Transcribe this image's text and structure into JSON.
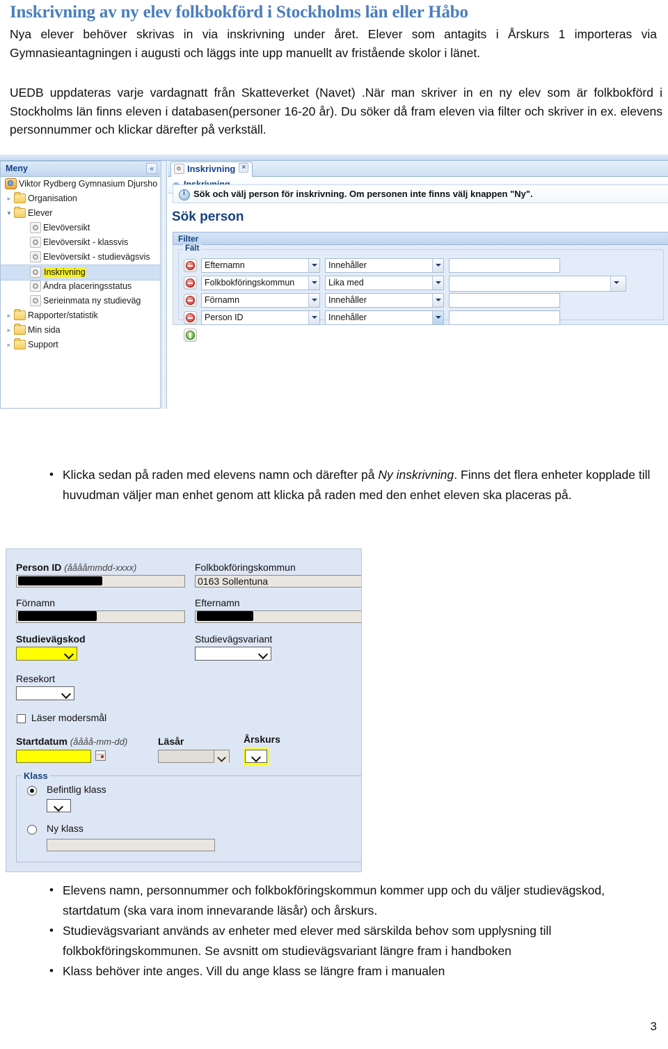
{
  "document": {
    "title": "Inskrivning av ny elev folkbokförd i Stockholms län eller Håbo",
    "paragraph1": "Nya elever behöver skrivas in via inskrivning under året. Elever som antagits i Årskurs 1 importeras via Gymnasieantagningen i augusti och läggs inte upp manuellt av fristående skolor i länet.",
    "paragraph2": "UEDB uppdateras varje vardagnatt från Skatteverket (Navet) .När man skriver in en ny elev som är folkbokförd i Stockholms län finns eleven i databasen(personer 16-20 år). Du söker då fram eleven via filter och skriver in ex. elevens personnummer och klickar därefter på verkställ.",
    "page_number": "3",
    "title_color": "#4A7EBB"
  },
  "bullets_middle": [
    {
      "pre": "Klicka sedan på raden med elevens namn och därefter på ",
      "italic": "Ny inskrivning",
      "post": ". Finns det flera enheter kopplade till huvudman väljer man enhet genom att klicka på raden med den enhet eleven ska placeras på."
    }
  ],
  "bullets_bottom": [
    "Elevens namn, personnummer och folkbokföringskommun kommer upp och du väljer studievägskod, startdatum (ska vara inom innevarande läsår) och årskurs.",
    "Studievägsvariant används av enheter med elever med särskilda behov som upplysning till folkbokföringskommunen. Se avsnitt om studievägsvariant längre fram i handboken",
    "Klass behöver inte anges. Vill du ange klass se längre fram i manualen"
  ],
  "screenshot1": {
    "menu": {
      "header_title": "Meny",
      "collapse_icon": "chevron-double-left-icon",
      "organisation_node": "Viktor Rydberg Gymnasium Djursho",
      "tree": [
        {
          "label": "Organisation",
          "type": "folder",
          "level": 1,
          "expanded": false,
          "selected": false
        },
        {
          "label": "Elever",
          "type": "folder",
          "level": 1,
          "expanded": true,
          "selected": false
        },
        {
          "label": "Elevöversikt",
          "type": "page",
          "level": 2,
          "selected": false
        },
        {
          "label": "Elevöversikt - klassvis",
          "type": "page",
          "level": 2,
          "selected": false
        },
        {
          "label": "Elevöversikt - studievägsvis",
          "type": "page",
          "level": 2,
          "selected": false
        },
        {
          "label": "Inskrivning",
          "type": "page",
          "level": 2,
          "selected": true,
          "highlighted": true
        },
        {
          "label": "Ändra placeringsstatus",
          "type": "page",
          "level": 2,
          "selected": false
        },
        {
          "label": "Serieinmata ny studieväg",
          "type": "page",
          "level": 2,
          "selected": false
        },
        {
          "label": "Rapporter/statistik",
          "type": "folder",
          "level": 1,
          "expanded": false,
          "selected": false
        },
        {
          "label": "Min sida",
          "type": "folder",
          "level": 1,
          "expanded": false,
          "selected": false
        },
        {
          "label": "Support",
          "type": "folder",
          "level": 1,
          "expanded": false,
          "selected": false
        }
      ]
    },
    "content": {
      "tab_label": "Inskrivning",
      "tab_close_icon": "close-icon",
      "breadcrumb": "Inskrivning",
      "info_message": "Sök och välj person för inskrivning. Om personen inte finns välj knappen \"Ny\".",
      "section_title": "Sök person",
      "filter_header": "Filter",
      "falt_legend": "Fält",
      "filter_rows": [
        {
          "remove_icon": "minus-circle-icon",
          "field": "Efternamn",
          "operator": "Innehåller",
          "value": "",
          "value_type": "text",
          "focused": false
        },
        {
          "remove_icon": "minus-circle-icon",
          "field": "Folkbokföringskommun",
          "operator": "Lika med",
          "value": "",
          "value_type": "combo",
          "focused": false
        },
        {
          "remove_icon": "minus-circle-icon",
          "field": "Förnamn",
          "operator": "Innehåller",
          "value": "",
          "value_type": "text",
          "focused": false
        },
        {
          "remove_icon": "minus-circle-icon",
          "field": "Person ID",
          "operator": "Innehåller",
          "value": "",
          "value_type": "text",
          "focused": true
        }
      ],
      "add_row_icon": "plus-circle-icon"
    }
  },
  "screenshot2": {
    "fields": {
      "person_id_label": "Person ID",
      "person_id_hint": "(ååååmmdd-xxxx)",
      "person_id_value": "",
      "folkbokforingskommun_label": "Folkbokföringskommun",
      "folkbokforingskommun_value": "0163 Sollentuna",
      "fornamn_label": "Förnamn",
      "fornamn_value": "",
      "efternamn_label": "Efternamn",
      "efternamn_value": "",
      "studievagskod_label": "Studievägskod",
      "studievagskod_value": "",
      "studievagsvariant_label": "Studievägsvariant",
      "studievagsvariant_value": "",
      "resekort_label": "Resekort",
      "resekort_value": "",
      "laser_modersmal_label": "Läser modersmål",
      "laser_modersmal_checked": false,
      "startdatum_label": "Startdatum",
      "startdatum_hint": "(åååå-mm-dd)",
      "startdatum_value": "",
      "calendar_icon": "calendar-icon",
      "lasar_label": "Läsår",
      "lasar_value": "",
      "arskurs_label": "Årskurs",
      "arskurs_value": ""
    },
    "klass": {
      "legend": "Klass",
      "option_existing": "Befintlig klass",
      "option_existing_selected": true,
      "option_existing_value": "",
      "option_new": "Ny klass",
      "option_new_selected": false,
      "option_new_value": ""
    },
    "highlight_color": "#ffff00"
  }
}
